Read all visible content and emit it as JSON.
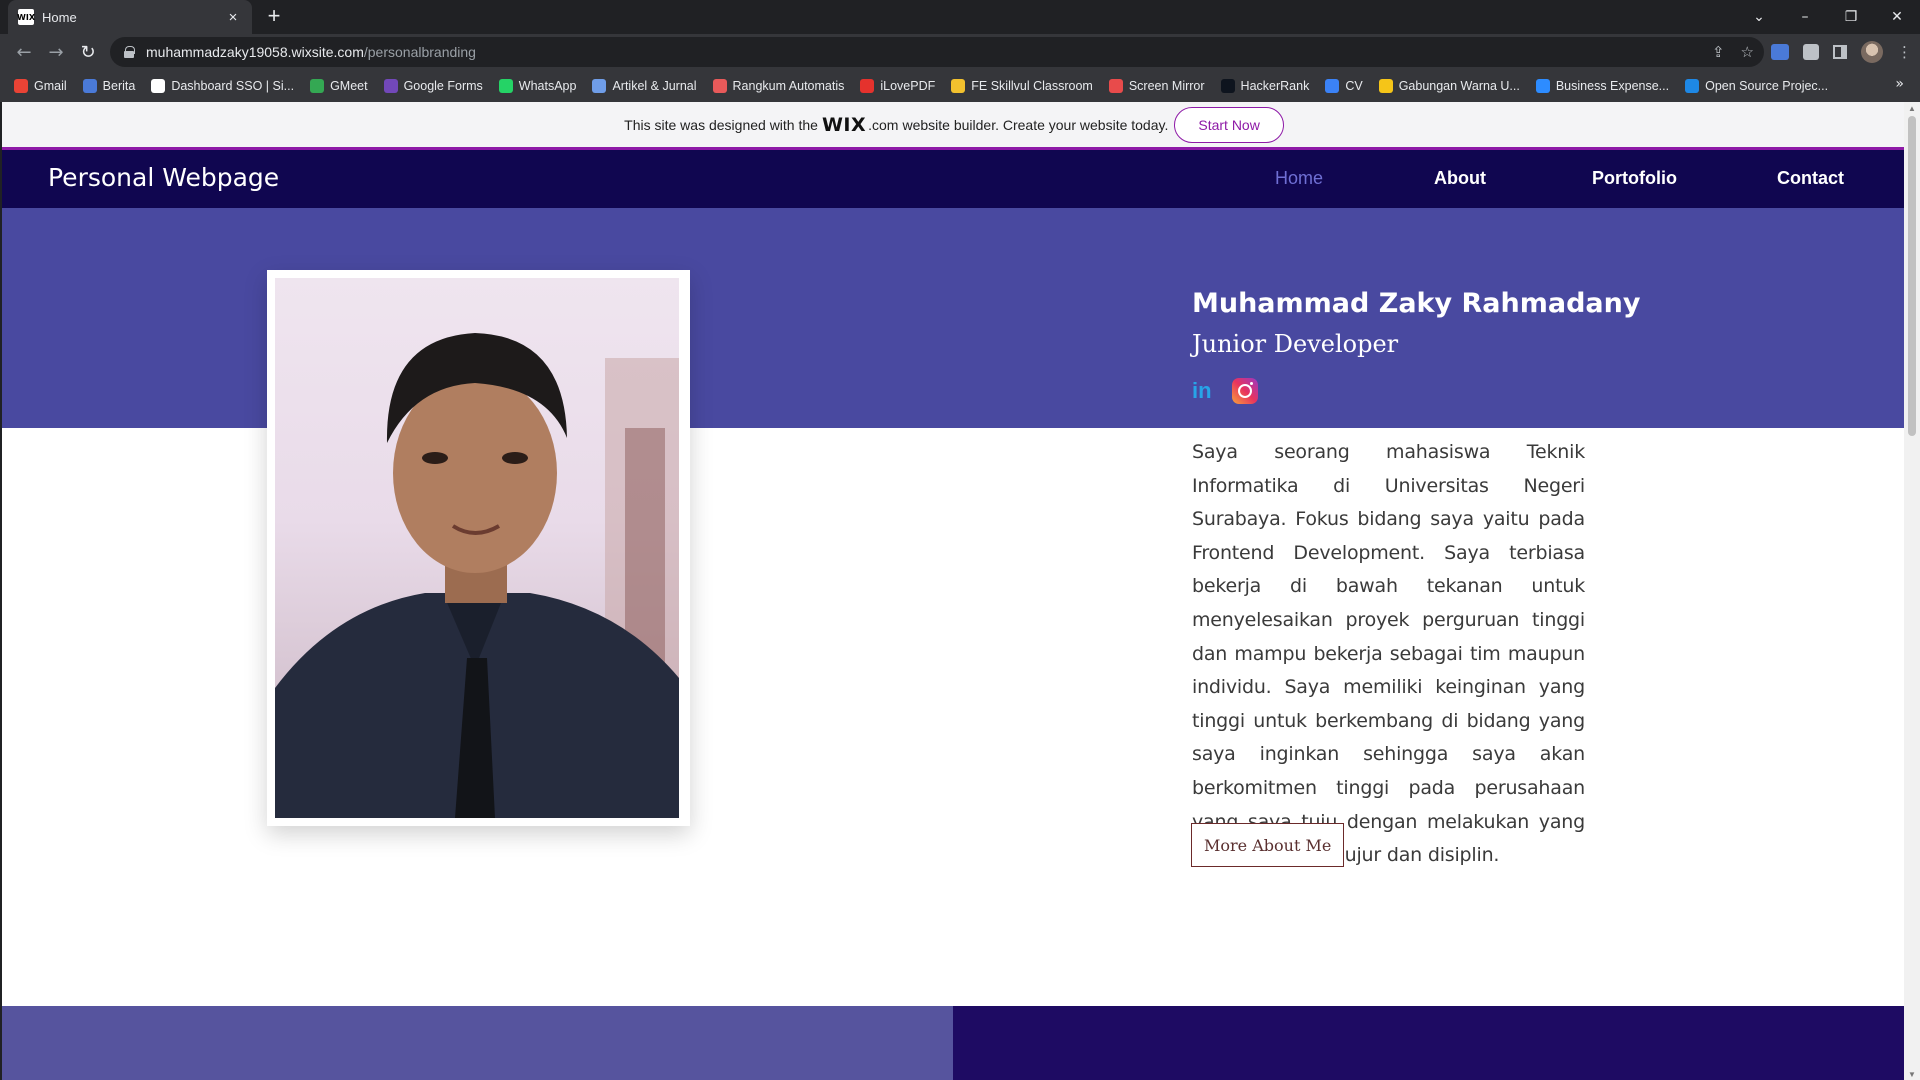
{
  "browser": {
    "tab_title": "Home",
    "tab_favicon": "WIX",
    "new_tab_symbol": "+",
    "url_host": "muhammadzaky19058.wixsite.com",
    "url_path": "/personalbranding",
    "bookmarks": [
      {
        "label": "Gmail",
        "color": "#ea4335"
      },
      {
        "label": "Berita",
        "color": "#4a7ad8"
      },
      {
        "label": "Dashboard SSO | Si...",
        "color": "#ffffff"
      },
      {
        "label": "GMeet",
        "color": "#34a853"
      },
      {
        "label": "Google Forms",
        "color": "#7248b9"
      },
      {
        "label": "WhatsApp",
        "color": "#25d366"
      },
      {
        "label": "Artikel & Jurnal",
        "color": "#6f9de8"
      },
      {
        "label": "Rangkum Automatis",
        "color": "#e85a5a"
      },
      {
        "label": "iLovePDF",
        "color": "#e5322d"
      },
      {
        "label": "FE Skillvul Classroom",
        "color": "#f2c12e"
      },
      {
        "label": "Screen Mirror",
        "color": "#e84b4b"
      },
      {
        "label": "HackerRank",
        "color": "#0e141e"
      },
      {
        "label": "CV",
        "color": "#3b82f6"
      },
      {
        "label": "Gabungan Warna U...",
        "color": "#f5c518"
      },
      {
        "label": "Business Expense...",
        "color": "#2d8cff"
      },
      {
        "label": "Open Source Projec...",
        "color": "#1e88e5"
      }
    ]
  },
  "wix_banner": {
    "text_before": "This site was designed with the",
    "logo": "WIX",
    "logo_suffix": ".com",
    "text_after": "website builder. Create your website today.",
    "button": "Start Now"
  },
  "header": {
    "site_title": "Personal Webpage",
    "nav": [
      "Home",
      "About",
      "Portofolio",
      "Contact"
    ]
  },
  "profile": {
    "name": "Muhammad Zaky Rahmadany",
    "role": "Junior Developer",
    "social": [
      "linkedin-icon",
      "instagram-icon"
    ],
    "linkedin_glyph": "in",
    "bio": "Saya seorang mahasiswa Teknik Informatika di Universitas Negeri Surabaya. Fokus bidang saya yaitu pada Frontend Development. Saya terbiasa bekerja di bawah tekanan untuk menyelesaikan proyek perguruan tinggi dan mampu bekerja sebagai tim maupun individu. Saya memiliki keinginan yang tinggi untuk berkembang di bidang yang saya inginkan sehingga saya akan berkomitmen tinggi pada perusahaan yang saya tuju dengan melakukan yang terbaik dengan jujur dan disiplin.",
    "more_button": "More About Me"
  },
  "colors": {
    "header_bg": "#100650",
    "hero_band": "#4949a0",
    "nav_active": "#6f6fd4",
    "wix_accent": "#8e1aa7",
    "bottom_left": "#56549e",
    "bottom_right": "#1e0b63"
  }
}
